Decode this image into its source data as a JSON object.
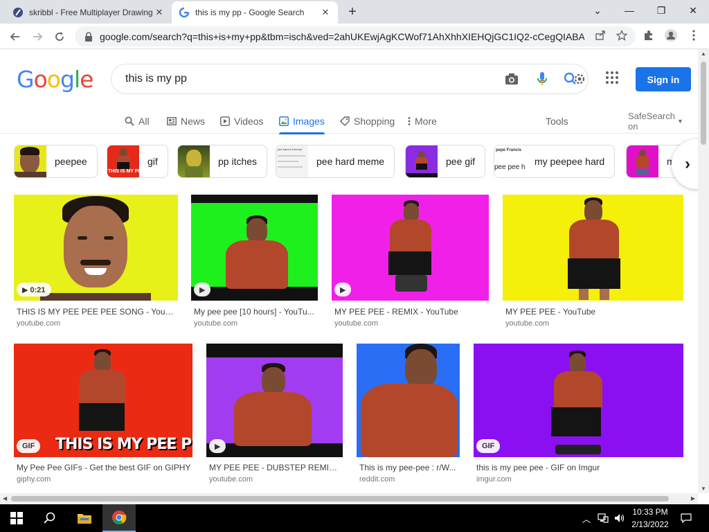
{
  "browser": {
    "tabs": [
      {
        "title": "skribbl - Free Multiplayer Drawing",
        "active": false
      },
      {
        "title": "this is my pp - Google Search",
        "active": true
      }
    ],
    "new_tab_symbol": "+",
    "url": "google.com/search?q=this+is+my+pp&tbm=isch&ved=2ahUKEwjAgKCWof71AhXhhXIEHQjGC1IQ2-cCegQIABA..."
  },
  "google": {
    "logo_letters": [
      {
        "ch": "G",
        "color": "#4285F4"
      },
      {
        "ch": "o",
        "color": "#EA4335"
      },
      {
        "ch": "o",
        "color": "#FBBC05"
      },
      {
        "ch": "g",
        "color": "#4285F4"
      },
      {
        "ch": "l",
        "color": "#34A853"
      },
      {
        "ch": "e",
        "color": "#EA4335"
      }
    ],
    "query": "this is my pp",
    "sign_in": "Sign in",
    "nav": [
      {
        "label": "All",
        "icon": "search-icon"
      },
      {
        "label": "News",
        "icon": "news-icon"
      },
      {
        "label": "Videos",
        "icon": "video-icon"
      },
      {
        "label": "Images",
        "icon": "image-icon",
        "active": true
      },
      {
        "label": "Shopping",
        "icon": "tag-icon"
      },
      {
        "label": "More",
        "icon": "more-vert-icon"
      }
    ],
    "tools": "Tools",
    "safesearch": "SafeSearch on",
    "accent": "#1a73e8"
  },
  "chips": [
    {
      "label": "peepee",
      "bg": "#e6e61a"
    },
    {
      "label": "gif",
      "bg": "#e52a1a"
    },
    {
      "label": "pp itches",
      "bg": "#8a9a2a"
    },
    {
      "label": "pee hard meme",
      "bg": "#f4f4f4",
      "thumb_caption": "pee hard is it funny?"
    },
    {
      "label": "pee gif",
      "bg": "#8b2be2"
    },
    {
      "label": "my peepee hard",
      "bg": "#ffffff",
      "thumb_caption": "pepe Francis",
      "thumb_caption2": "pee pee h"
    },
    {
      "label": "m",
      "bg": "#e010c8"
    }
  ],
  "results": [
    {
      "caption": "THIS IS MY PEE PEE PEE SONG - YouTu...",
      "source": "youtube.com",
      "bg": "#e8f01a",
      "badge": "▶ 0:21"
    },
    {
      "caption": "My pee pee [10 hours] - YouTu...",
      "source": "youtube.com",
      "bg": "#1ef01e",
      "badge": "▶"
    },
    {
      "caption": "MY PEE PEE - REMIX - YouTube",
      "source": "youtube.com",
      "bg": "#f020e8",
      "badge": "▶"
    },
    {
      "caption": "MY PEE PEE - YouTube",
      "source": "youtube.com",
      "bg": "#f5f00a",
      "badge": ""
    },
    {
      "caption": "My Pee Pee GIFs - Get the best GIF on GIPHY",
      "source": "giphy.com",
      "bg": "#ea2a12",
      "badge": "GIF",
      "overlay_text": "THIS IS MY PEE PEE."
    },
    {
      "caption": "MY PEE PEE - DUBSTEP REMIX - ...",
      "source": "youtube.com",
      "bg": "#a23cf0",
      "badge": "▶"
    },
    {
      "caption": "This is my pee-pee : r/W...",
      "source": "reddit.com",
      "bg": "#2a6ef5",
      "badge": ""
    },
    {
      "caption": "this is my pee pee - GIF on Imgur",
      "source": "imgur.com",
      "bg": "#8a10f2",
      "badge": "GIF"
    }
  ],
  "taskbar": {
    "time": "10:33 PM",
    "date": "2/13/2022"
  }
}
